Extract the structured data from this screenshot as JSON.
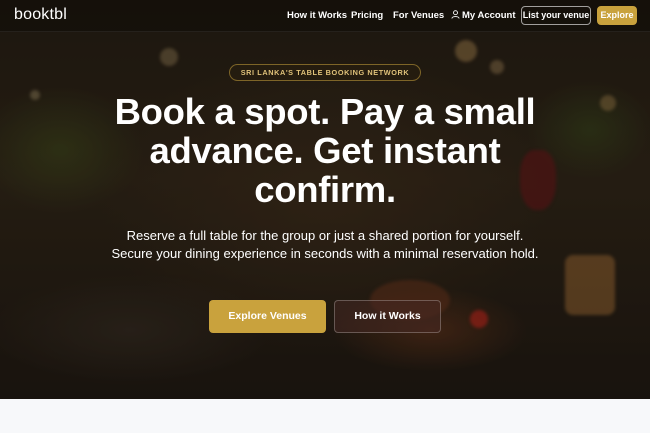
{
  "brand": {
    "logo": "booktbl",
    "accent": "#c9a23d"
  },
  "nav": {
    "links": [
      "How it Works",
      "Pricing",
      "For Venues"
    ],
    "account": "My Account",
    "list_venue": "List your venue",
    "explore": "Explore"
  },
  "hero": {
    "badge": "SRI LANKA'S TABLE BOOKING NETWORK",
    "headline": "Book a spot. Pay a small advance. Get instant confirm.",
    "subtext": "Reserve a full table for the group or just a shared portion for yourself. Secure your dining experience in seconds with a minimal reservation hold.",
    "cta_primary": "Explore Venues",
    "cta_secondary": "How it Works"
  }
}
